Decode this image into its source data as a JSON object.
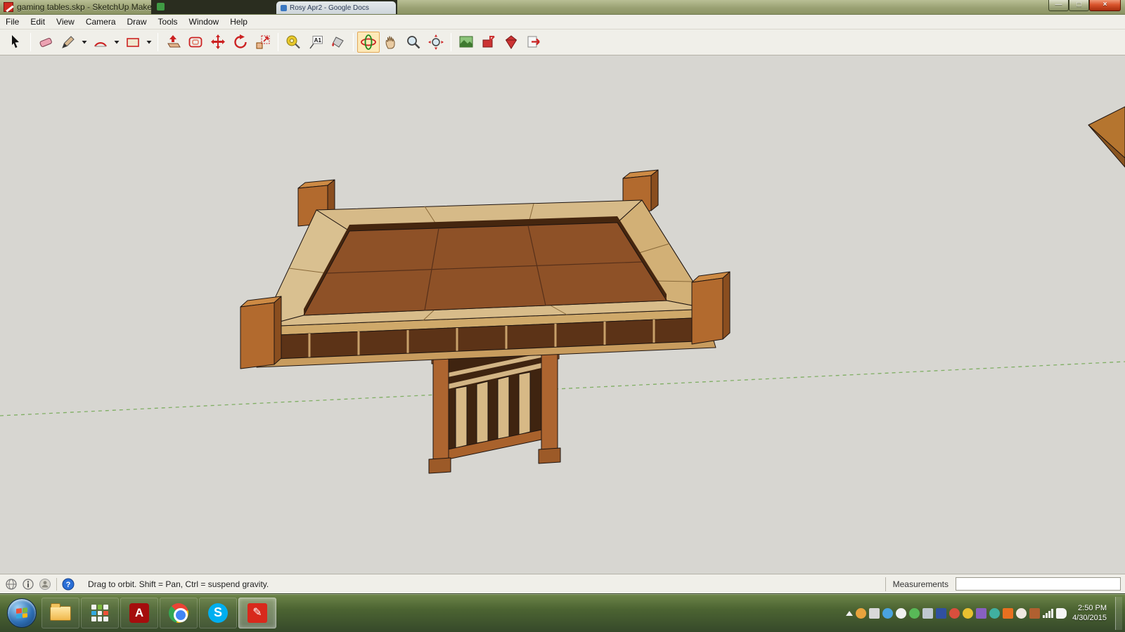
{
  "window": {
    "title": "gaming tables.skp - SketchUp Make",
    "background_tab_title": "Rosy Apr2 - Google Docs",
    "controls": {
      "minimize": "—",
      "maximize": "□",
      "close": "×"
    }
  },
  "menubar": {
    "items": [
      "File",
      "Edit",
      "View",
      "Camera",
      "Draw",
      "Tools",
      "Window",
      "Help"
    ]
  },
  "toolbar": {
    "active_tool": "Orbit",
    "text_tool_label": "A1",
    "tools": [
      "Select",
      "Eraser",
      "Line",
      "Arcs",
      "Shapes",
      "Push/Pull",
      "Offset",
      "Move",
      "Rotate",
      "Scale",
      "Tape Measure",
      "Text",
      "Paint Bucket",
      "Orbit",
      "Pan",
      "Zoom",
      "Zoom Extents",
      "3D Warehouse",
      "Share Model",
      "Extension Warehouse",
      "Send to LayOut"
    ]
  },
  "canvas": {
    "model": "pedestal gaming table",
    "colors": {
      "background": "#d7d6d1",
      "table_surface": "#8e5127",
      "rail_wood": "#d6ba88",
      "post_wood": "#b26a2e",
      "axis_green": "#7fae63"
    }
  },
  "statusbar": {
    "hint": "Drag to orbit. Shift = Pan, Ctrl = suspend gravity.",
    "help_glyph": "?",
    "measurements_label": "Measurements",
    "measurements_value": ""
  },
  "taskbar": {
    "apps": [
      "Start",
      "Windows Explorer",
      "Apps",
      "Adobe Reader",
      "Google Chrome",
      "Skype",
      "SketchUp"
    ],
    "clock": {
      "time": "2:50 PM",
      "date": "4/30/2015"
    }
  }
}
